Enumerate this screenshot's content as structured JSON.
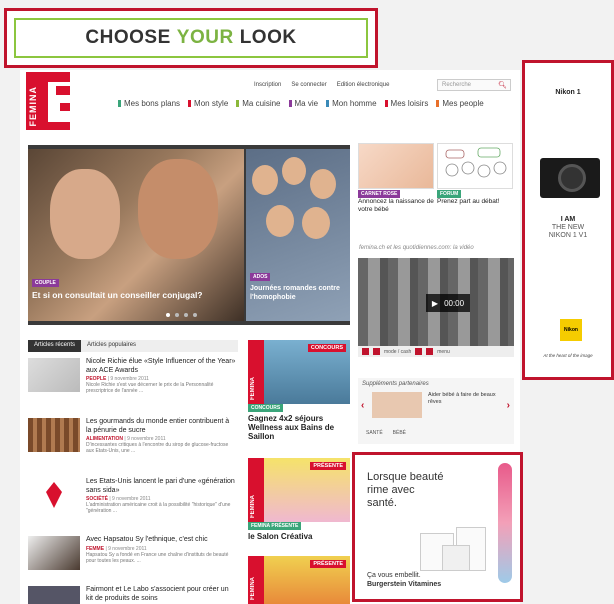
{
  "banner": {
    "choose": "CHOOSE",
    "your": "YOUR",
    "look": "LOOK"
  },
  "logo": {
    "text": "FEMINA"
  },
  "toplinks": [
    "Inscription",
    "Se connecter",
    "Edition électronique"
  ],
  "search": {
    "placeholder": "Recherche",
    "icon": "search-icon"
  },
  "nav": [
    {
      "label": "Mes bons plans",
      "color": "#3aa57a"
    },
    {
      "label": "Mon style",
      "color": "#d8102e"
    },
    {
      "label": "Ma cuisine",
      "color": "#8bb83a"
    },
    {
      "label": "Ma vie",
      "color": "#8b3a9a"
    },
    {
      "label": "Mon homme",
      "color": "#3a8ab8"
    },
    {
      "label": "Mes loisirs",
      "color": "#d8102e"
    },
    {
      "label": "Mes people",
      "color": "#e8702a"
    }
  ],
  "hero": {
    "main": {
      "tag": "COUPLE",
      "title": "Et si on consultait un conseiller conjugal?"
    },
    "side": {
      "tag": "ADOS",
      "title": "Journées romandes contre l'homophobie"
    }
  },
  "thumbs": [
    {
      "tag": "CARNET ROSE",
      "caption": "Annoncez la naissance de votre bébé"
    },
    {
      "tag": "FORUM",
      "caption": "Prenez part au débat!"
    }
  ],
  "video": {
    "label": "femina.ch et les quotidiennes.com: la vidéo",
    "time": "00:00",
    "controls": [
      "mode / cash",
      "menu"
    ]
  },
  "partners": {
    "title": "Suppléments partenaires",
    "text": "Aider bébé à faire de beaux rêves",
    "links": [
      "SANTÉ",
      "BÉBÉ"
    ]
  },
  "tabs": [
    "Articles récents",
    "Articles populaires"
  ],
  "articles": [
    {
      "title": "Nicole Richie élue «Style Influencer of the Year» aux ACE Awards",
      "cat": "PEOPLE",
      "date": "| 9 novembre 2011",
      "desc": "Nicole Richie s'est vue décerner le prix de la Personnalité prescriptrice de l'année ..."
    },
    {
      "title": "Les gourmands du monde entier contribuent à la pénurie de sucre",
      "cat": "ALIMENTATION",
      "date": "| 9 novembre 2011",
      "desc": "D'incessantes critiques à l'encontre du sirop de glucose-fructose aux Etats-Unis, une ..."
    },
    {
      "title": "Les Etats-Unis lancent le pari d'une «génération sans sida»",
      "cat": "SOCIÉTÉ",
      "date": "| 9 novembre 2011",
      "desc": "L'administration américaine croit à la possibilité \"historique\" d'une \"génération ..."
    },
    {
      "title": "Avec Hapsatou Sy l'ethnique, c'est chic",
      "cat": "FEMME",
      "date": "| 9 novembre 2011",
      "desc": "Hapsatou Sy a fondé en France une chaîne d'instituts de beauté pour toutes les peaux. ..."
    },
    {
      "title": "Fairmont et Le Labo s'associent pour créer un kit de produits de soins",
      "cat": "",
      "date": "",
      "desc": ""
    }
  ],
  "promos": [
    {
      "badge": "CONCOURS",
      "tag": "CONCOURS",
      "title": "Gagnez 4x2 séjours Wellness aux Bains de Saillon"
    },
    {
      "badge": "PRÉSENTE",
      "tag": "FEMINA PRÉSENTE",
      "title": "le Salon Créativa"
    },
    {
      "badge": "PRÉSENTE",
      "tag": "",
      "title": ""
    }
  ],
  "nikon_ad": {
    "brand": "Nikon 1",
    "line1": "I AM",
    "line2": "THE NEW",
    "line3": "NIKON 1 V1",
    "logo": "Nikon",
    "slogan": "At the heart of the image"
  },
  "burgerstein_ad": {
    "headline1": "Lorsque beauté",
    "headline2": "rime avec",
    "headline3": "santé.",
    "sub1": "Ça vous embellit.",
    "sub2": "Burgerstein Vitamines"
  },
  "colors": {
    "accent_red": "#c0142d",
    "femina_red": "#d8102e",
    "green": "#8cc63f"
  }
}
